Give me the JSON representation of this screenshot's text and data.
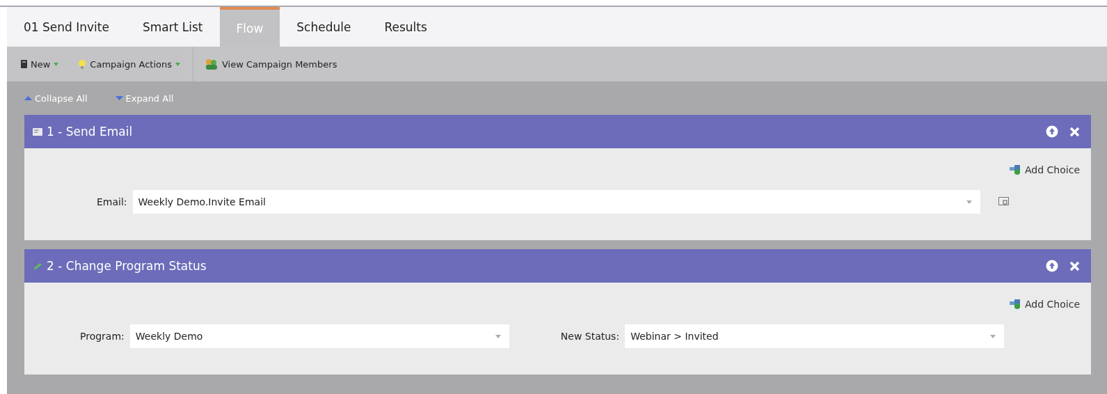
{
  "tabs": [
    {
      "label": "01 Send Invite",
      "selected": false
    },
    {
      "label": "Smart List",
      "selected": false
    },
    {
      "label": "Flow",
      "selected": true
    },
    {
      "label": "Schedule",
      "selected": false
    },
    {
      "label": "Results",
      "selected": false
    }
  ],
  "toolbar": [
    {
      "kind": "new",
      "label": "New",
      "dropdown": true
    },
    {
      "kind": "actions",
      "label": "Campaign Actions",
      "dropdown": true
    },
    {
      "kind": "members",
      "label": "View Campaign Members",
      "dropdown": false
    }
  ],
  "outline_controls": [
    {
      "kind": "collapse",
      "label": "Collapse All"
    },
    {
      "kind": "expand",
      "label": "Expand All"
    }
  ],
  "steps": [
    {
      "kind": "send_email",
      "title": "1 - Send Email",
      "add_choice": "Add Choice",
      "fields": [
        {
          "label": "Email:",
          "value": "Weekly Demo.Invite Email"
        }
      ]
    },
    {
      "kind": "change_status",
      "title": "2 - Change Program Status",
      "add_choice": "Add Choice",
      "fields": [
        {
          "label": "Program:",
          "value": "Weekly Demo"
        },
        {
          "label": "New Status:",
          "value": "Webinar > Invited"
        }
      ]
    }
  ]
}
